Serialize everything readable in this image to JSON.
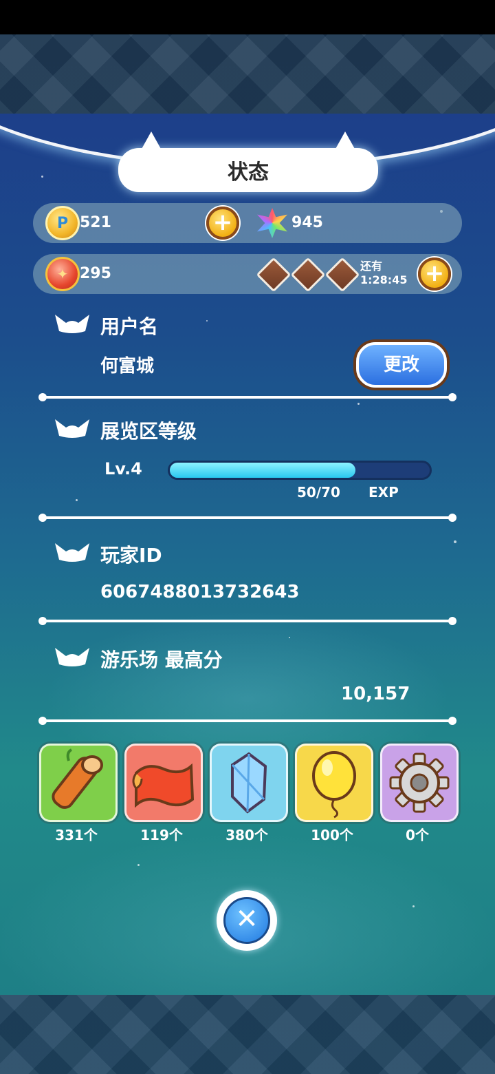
{
  "window": {
    "title": "状态"
  },
  "currency": {
    "coins": "521",
    "gems": "945",
    "tickets": "295",
    "refill_label": "还有",
    "refill_timer": "1:28:45"
  },
  "sections": {
    "username": {
      "title": "用户名",
      "value": "何富城",
      "change_label": "更改"
    },
    "exhibit_level": {
      "title": "展览区等级",
      "level": "Lv.4",
      "exp_text": "50/70",
      "exp_unit": "EXP",
      "exp_current": 50,
      "exp_max": 70
    },
    "player_id": {
      "title": "玩家ID",
      "value": "6067488013732643"
    },
    "high_score": {
      "title": "游乐场 最高分",
      "value": "10,157"
    }
  },
  "items": [
    {
      "icon": "wood-log-icon",
      "count": "331个",
      "color": "#7fcf4a"
    },
    {
      "icon": "red-cloth-icon",
      "count": "119个",
      "color": "#f27a6a"
    },
    {
      "icon": "crystal-icon",
      "count": "380个",
      "color": "#7fd4ee"
    },
    {
      "icon": "balloon-icon",
      "count": "100个",
      "color": "#f7d84a"
    },
    {
      "icon": "gear-icon",
      "count": "0个",
      "color": "#c9a2e8"
    }
  ],
  "colors": {
    "accent_blue": "#2b6fe0",
    "exp_fill": "#29c7f0",
    "brown": "#6a3a1a"
  }
}
